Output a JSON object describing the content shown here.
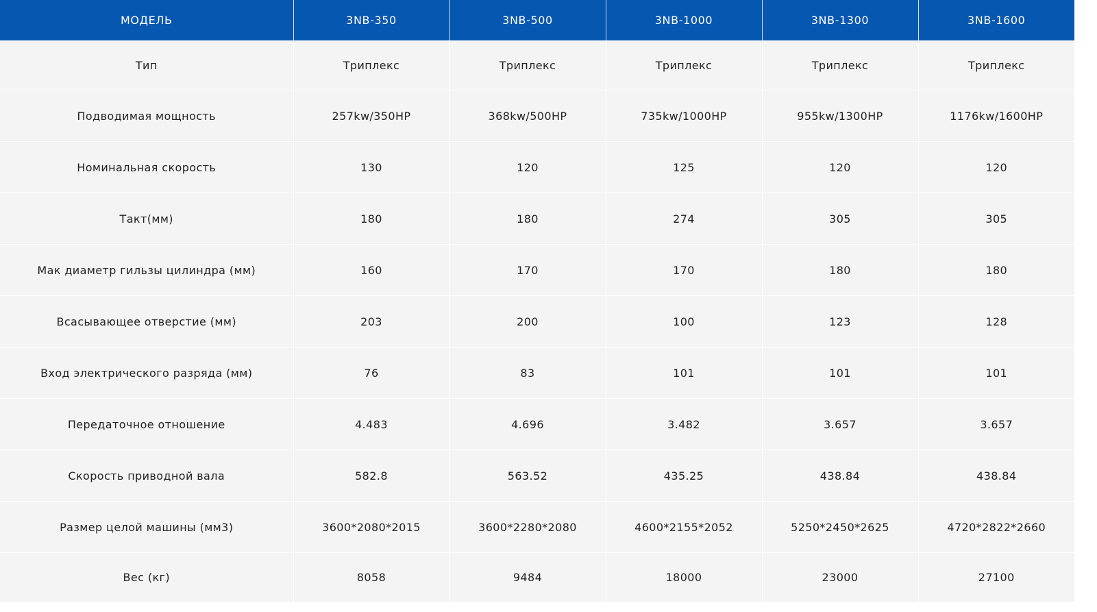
{
  "table": {
    "headers": [
      "МОДЕЛЬ",
      "3NB-350",
      "3NB-500",
      "3NB-1000",
      "3NB-1300",
      "3NB-1600"
    ],
    "rows": [
      [
        "Тип",
        "Триплекс",
        "Триплекс",
        "Триплекс",
        "Триплекс",
        "Триплекс"
      ],
      [
        "Подводимая мощность",
        "257kw/350HP",
        "368kw/500HP",
        "735kw/1000HP",
        "955kw/1300HP",
        "1176kw/1600HP"
      ],
      [
        "Номинальная скорость",
        "130",
        "120",
        "125",
        "120",
        "120"
      ],
      [
        "Такт(мм)",
        "180",
        "180",
        "274",
        "305",
        "305"
      ],
      [
        "Мак диаметр гильзы цилиндра  (мм)",
        "160",
        "170",
        "170",
        "180",
        "180"
      ],
      [
        "Всасывающее отверстие (мм)",
        "203",
        "200",
        "100",
        "123",
        "128"
      ],
      [
        "Вход электрического разряда (мм)",
        "76",
        "83",
        "101",
        "101",
        "101"
      ],
      [
        "Передаточное отношение",
        "4.483",
        "4.696",
        "3.482",
        "3.657",
        "3.657"
      ],
      [
        "Скорость приводной вала",
        "582.8",
        "563.52",
        "435.25",
        "438.84",
        "438.84"
      ],
      [
        "Размер целой машины (мм3)",
        "3600*2080*2015",
        "3600*2280*2080",
        "4600*2155*2052",
        "5250*2450*2625",
        "4720*2822*2660"
      ],
      [
        "Вес (кг)",
        "8058",
        "9484",
        "18000",
        "23000",
        "27100"
      ]
    ]
  },
  "colors": {
    "header_background": "#0657b0",
    "header_text": "#ffffff",
    "cell_background": "#f4f4f4",
    "cell_text": "#222222"
  }
}
